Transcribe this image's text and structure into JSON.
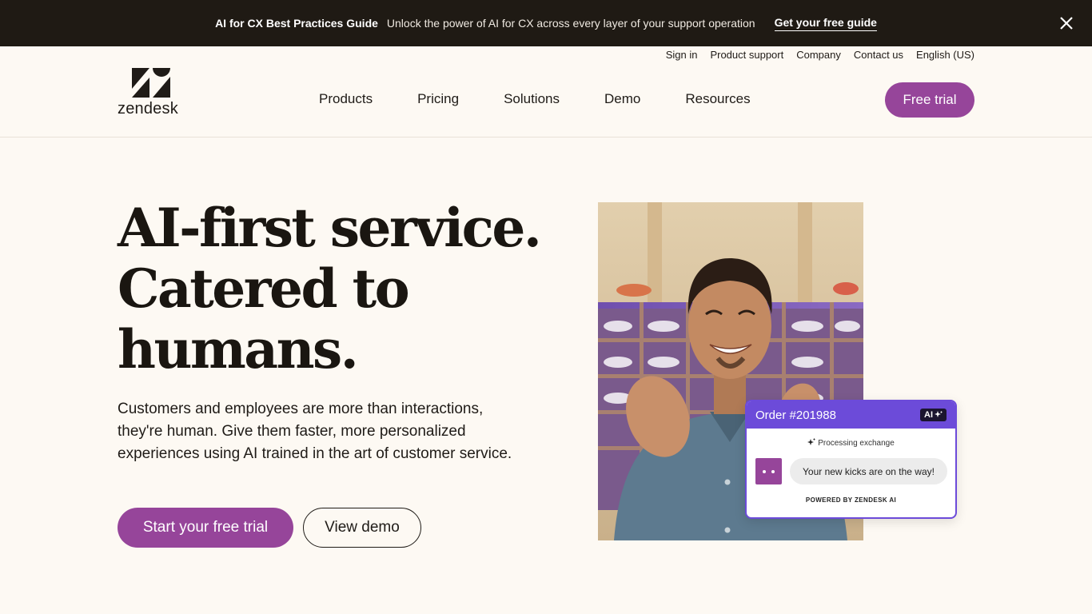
{
  "banner": {
    "title": "AI for CX Best Practices Guide",
    "text": "Unlock the power of AI for CX across every layer of your support operation",
    "link": "Get your free guide",
    "close_icon": "close-icon"
  },
  "header": {
    "utility_links": [
      "Sign in",
      "Product support",
      "Company",
      "Contact us",
      "English (US)"
    ],
    "logo_text": "zendesk",
    "nav": [
      "Products",
      "Pricing",
      "Solutions",
      "Demo",
      "Resources"
    ],
    "trial_button": "Free trial"
  },
  "hero": {
    "title_lines": [
      "AI-first service.",
      "Catered to",
      "humans."
    ],
    "description": "Customers and employees are more than interactions, they're human. Give them faster, more personalized experiences using AI trained in the art of customer service.",
    "primary_cta": "Start your free trial",
    "secondary_cta": "View demo"
  },
  "card": {
    "order": "Order #201988",
    "ai_badge": "AI",
    "processing": "Processing exchange",
    "message": "Your new kicks are on the way!",
    "powered_by": "POWERED BY ZENDESK AI"
  },
  "colors": {
    "brand_purple": "#96459a",
    "card_purple": "#6c4bd9",
    "banner_bg": "#1f1a14",
    "page_bg": "#fdf9f3"
  }
}
